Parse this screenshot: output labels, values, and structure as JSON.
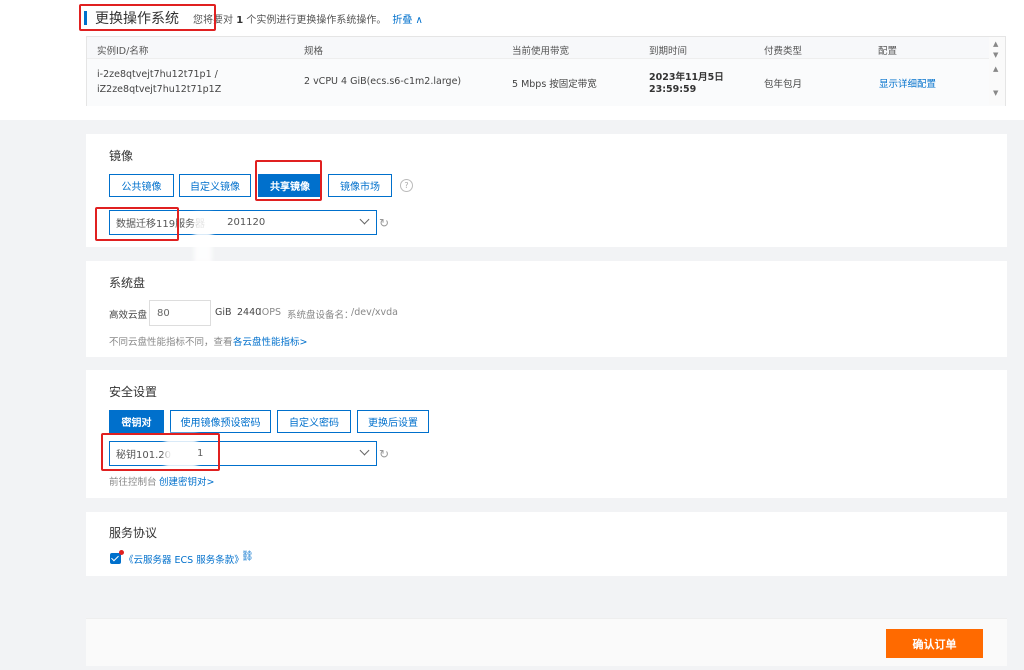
{
  "header": {
    "title": "更换操作系统",
    "sub_prefix": "您将要对",
    "count": "1",
    "sub_suffix": "个实例进行更换操作系统操作。",
    "collapse": "折叠 ∧"
  },
  "table": {
    "columns": [
      "实例ID/名称",
      "规格",
      "当前使用带宽",
      "到期时间",
      "付费类型",
      "配置"
    ],
    "row": {
      "id_line1": "i-2ze8qtvejt7hu12t71p1 /",
      "id_line2": "iZ2ze8qtvejt7hu12t71p1Z",
      "spec": "2 vCPU 4 GiB(ecs.s6-c1m2.large)",
      "bandwidth": "5 Mbps 按固定带宽",
      "expire_date": "2023年11月5日",
      "expire_time": "23:59:59",
      "pay_type": "包年包月",
      "config_link": "显示详细配置"
    }
  },
  "image": {
    "title": "镜像",
    "tabs": [
      "公共镜像",
      "自定义镜像",
      "共享镜像",
      "镜像市场"
    ],
    "active_tab": "共享镜像",
    "help": "?",
    "selected_part1": "数据迁移119服务器",
    "selected_part2": "201120"
  },
  "disk": {
    "title": "系统盘",
    "type": "高效云盘",
    "size": "80",
    "unit": "GiB",
    "iops": "2440",
    "iops_unit": "IOPS",
    "device_label": "系统盘设备名：",
    "device": "/dev/xvda",
    "hint": "不同云盘性能指标不同，查看",
    "hint_link": "各云盘性能指标>"
  },
  "security": {
    "title": "安全设置",
    "tabs": [
      "密钥对",
      "使用镜像预设密码",
      "自定义密码",
      "更换后设置"
    ],
    "active_tab": "密钥对",
    "selected_part1": "秘钥101.20",
    "selected_part2": "1",
    "hint": "前往控制台",
    "hint_link": "创建密钥对>"
  },
  "agreement": {
    "title": "服务协议",
    "text": "《云服务器 ECS 服务条款》"
  },
  "footer": {
    "confirm": "确认订单"
  },
  "colors": {
    "primary": "#0070cc",
    "confirm": "#ff6a00",
    "highlight": "#e02020"
  }
}
